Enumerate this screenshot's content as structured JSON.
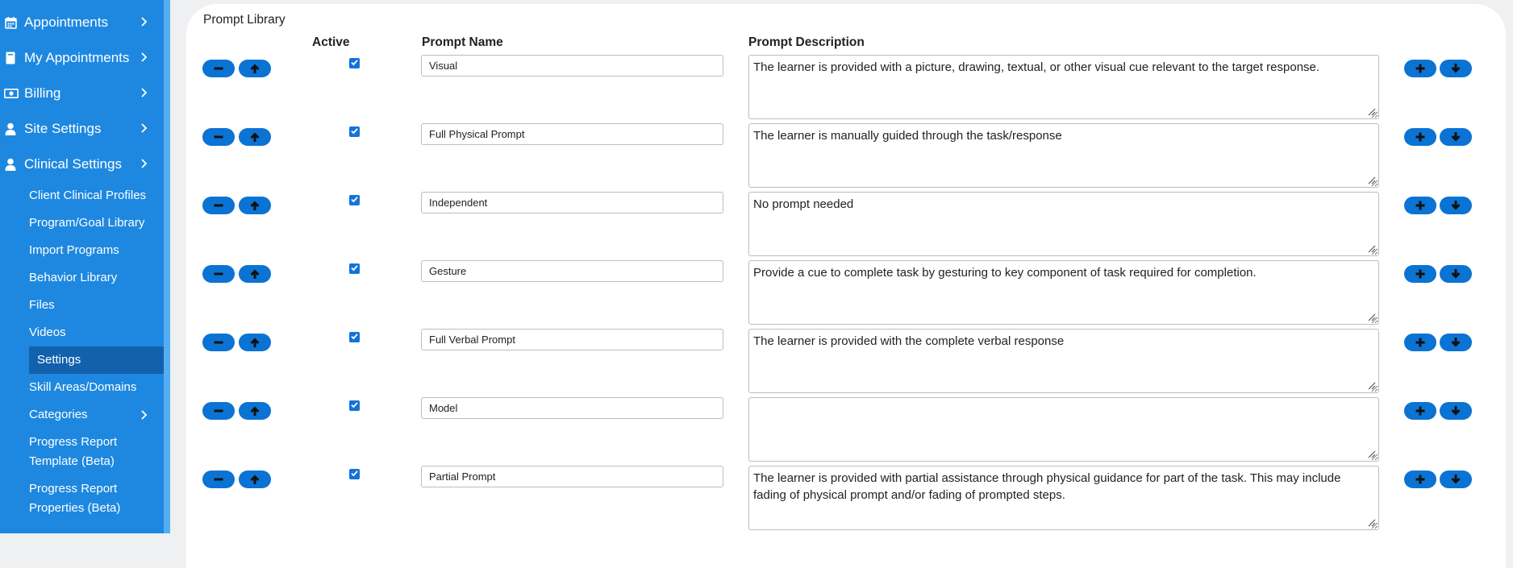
{
  "sidebar": {
    "top_items": [
      {
        "label": "Appointments",
        "icon": "calendar-icon"
      },
      {
        "label": "My Appointments",
        "icon": "bookmark-icon"
      },
      {
        "label": "Billing",
        "icon": "money-icon"
      },
      {
        "label": "Site Settings",
        "icon": "user-icon"
      },
      {
        "label": "Clinical Settings",
        "icon": "user-icon"
      }
    ],
    "sub_items": [
      {
        "label": "Client Clinical Profiles"
      },
      {
        "label": "Program/Goal Library"
      },
      {
        "label": "Import Programs"
      },
      {
        "label": "Behavior Library"
      },
      {
        "label": "Files"
      },
      {
        "label": "Videos"
      },
      {
        "label": "Settings",
        "active": true
      },
      {
        "label": "Skill Areas/Domains"
      },
      {
        "label": "Categories"
      },
      {
        "label": "Progress Report Template (Beta)"
      },
      {
        "label": "Progress Report Properties (Beta)"
      }
    ]
  },
  "page": {
    "title": "Prompt Library",
    "columns": {
      "active": "Active",
      "name": "Prompt Name",
      "description": "Prompt Description"
    }
  },
  "prompts": [
    {
      "active": true,
      "name": "Visual",
      "description": "The learner is provided with a picture, drawing, textual, or other visual cue relevant to the target response."
    },
    {
      "active": true,
      "name": "Full Physical Prompt",
      "description": "The learner is manually guided through the task/response"
    },
    {
      "active": true,
      "name": "Independent",
      "description": "No prompt needed"
    },
    {
      "active": true,
      "name": "Gesture",
      "description": "Provide a cue to complete task by gesturing to key component of task required for completion."
    },
    {
      "active": true,
      "name": "Full Verbal Prompt",
      "description": "The learner is provided with the complete verbal response"
    },
    {
      "active": true,
      "name": "Model",
      "description": ""
    },
    {
      "active": true,
      "name": "Partial Prompt",
      "description": "The learner is provided with partial assistance through physical guidance for part of the task. This may include fading of physical prompt and/or fading of prompted steps."
    }
  ],
  "colors": {
    "sidebar": "#1e88e0",
    "sidebar_active": "#1361ad",
    "button": "#0b73d3"
  }
}
